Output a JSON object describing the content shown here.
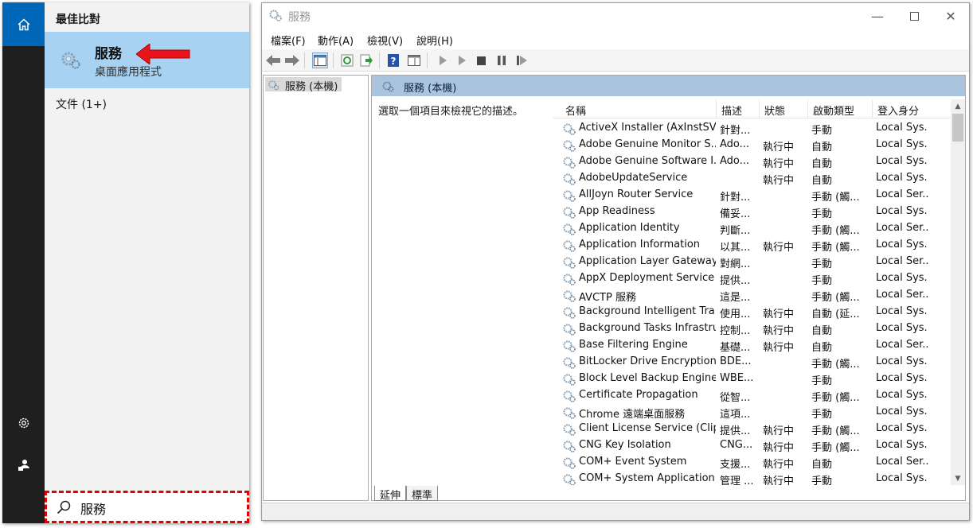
{
  "start_menu": {
    "best_match_header": "最佳比對",
    "best_match": {
      "title": "服務",
      "subtitle": "桌面應用程式"
    },
    "documents": "文件 (1+)",
    "search": {
      "value": "服務"
    },
    "accent_color": "#0067b8",
    "highlight_color": "#a8d2f2"
  },
  "window": {
    "title": "服務",
    "menu": [
      "檔案(F)",
      "動作(A)",
      "檢視(V)",
      "說明(H)"
    ],
    "tree": {
      "item": "服務 (本機)"
    },
    "pane": {
      "header": "服務 (本機)",
      "description": "選取一個項目來檢視它的描述。"
    },
    "columns": [
      "名稱",
      "描述",
      "狀態",
      "啟動類型",
      "登入身分"
    ],
    "rows": [
      [
        "ActiveX Installer (AxInstSV)",
        "針對...",
        "",
        "手動",
        "Local Sys..."
      ],
      [
        "Adobe Genuine Monitor S...",
        "Ado...",
        "執行中",
        "自動",
        "Local Sys..."
      ],
      [
        "Adobe Genuine Software I...",
        "Ado...",
        "執行中",
        "自動",
        "Local Sys..."
      ],
      [
        "AdobeUpdateService",
        "",
        "執行中",
        "自動",
        "Local Sys..."
      ],
      [
        "AllJoyn Router Service",
        "針對...",
        "",
        "手動 (觸...",
        "Local Ser..."
      ],
      [
        "App Readiness",
        "備妥...",
        "",
        "手動",
        "Local Sys..."
      ],
      [
        "Application Identity",
        "判斷...",
        "",
        "手動 (觸...",
        "Local Ser..."
      ],
      [
        "Application Information",
        "以其...",
        "執行中",
        "手動 (觸...",
        "Local Sys..."
      ],
      [
        "Application Layer Gateway ...",
        "對網...",
        "",
        "手動",
        "Local Ser..."
      ],
      [
        "AppX Deployment Service ...",
        "提供...",
        "",
        "手動",
        "Local Sys..."
      ],
      [
        "AVCTP 服務",
        "這是...",
        "",
        "手動 (觸...",
        "Local Ser..."
      ],
      [
        "Background Intelligent Tra...",
        "使用...",
        "執行中",
        "自動 (延...",
        "Local Sys..."
      ],
      [
        "Background Tasks Infrastru...",
        "控制...",
        "執行中",
        "自動",
        "Local Sys..."
      ],
      [
        "Base Filtering Engine",
        "基礎...",
        "執行中",
        "自動",
        "Local Ser..."
      ],
      [
        "BitLocker Drive Encryption ...",
        "BDE...",
        "",
        "手動 (觸...",
        "Local Sys..."
      ],
      [
        "Block Level Backup Engine ...",
        "WBE...",
        "",
        "手動",
        "Local Sys..."
      ],
      [
        "Certificate Propagation",
        "從智...",
        "",
        "手動 (觸...",
        "Local Sys..."
      ],
      [
        "Chrome 遠端桌面服務",
        "這項...",
        "",
        "手動",
        "Local Sys..."
      ],
      [
        "Client License Service (Clip...",
        "提供...",
        "執行中",
        "手動 (觸...",
        "Local Sys..."
      ],
      [
        "CNG Key Isolation",
        "CNG...",
        "執行中",
        "手動 (觸...",
        "Local Sys..."
      ],
      [
        "COM+ Event System",
        "支援...",
        "執行中",
        "自動",
        "Local Ser..."
      ],
      [
        "COM+ System Application",
        "管理 ...",
        "執行中",
        "手動",
        "Local Sys..."
      ]
    ],
    "tabs": [
      "延伸",
      "標準"
    ],
    "header_color": "#aac4dd"
  }
}
